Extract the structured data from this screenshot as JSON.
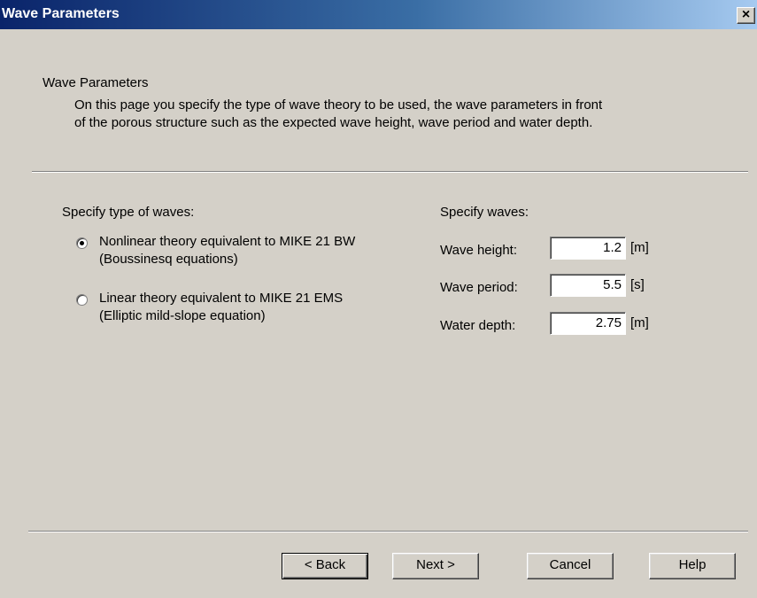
{
  "window": {
    "title": "Wave Parameters",
    "close_glyph": "×"
  },
  "header": {
    "title": "Wave Parameters",
    "description_line1": "On this page you specify the type of wave theory to be used, the wave parameters in front",
    "description_line2": "of the porous structure such as the expected wave height, wave period and water depth."
  },
  "wave_type": {
    "label": "Specify type of waves:",
    "options": [
      {
        "line1": "Nonlinear theory equivalent to MIKE 21 BW",
        "line2": "(Boussinesq equations)",
        "selected": true
      },
      {
        "line1": "Linear theory equivalent to MIKE 21 EMS",
        "line2": "(Elliptic mild-slope equation)",
        "selected": false
      }
    ]
  },
  "waves": {
    "label": "Specify waves:",
    "fields": [
      {
        "label": "Wave height:",
        "value": "1.2",
        "unit": "[m]"
      },
      {
        "label": "Wave period:",
        "value": "5.5",
        "unit": "[s]"
      },
      {
        "label": "Water depth:",
        "value": "2.75",
        "unit": "[m]"
      }
    ]
  },
  "buttons": {
    "back": "< Back",
    "next": "Next >",
    "cancel": "Cancel",
    "help": "Help"
  }
}
